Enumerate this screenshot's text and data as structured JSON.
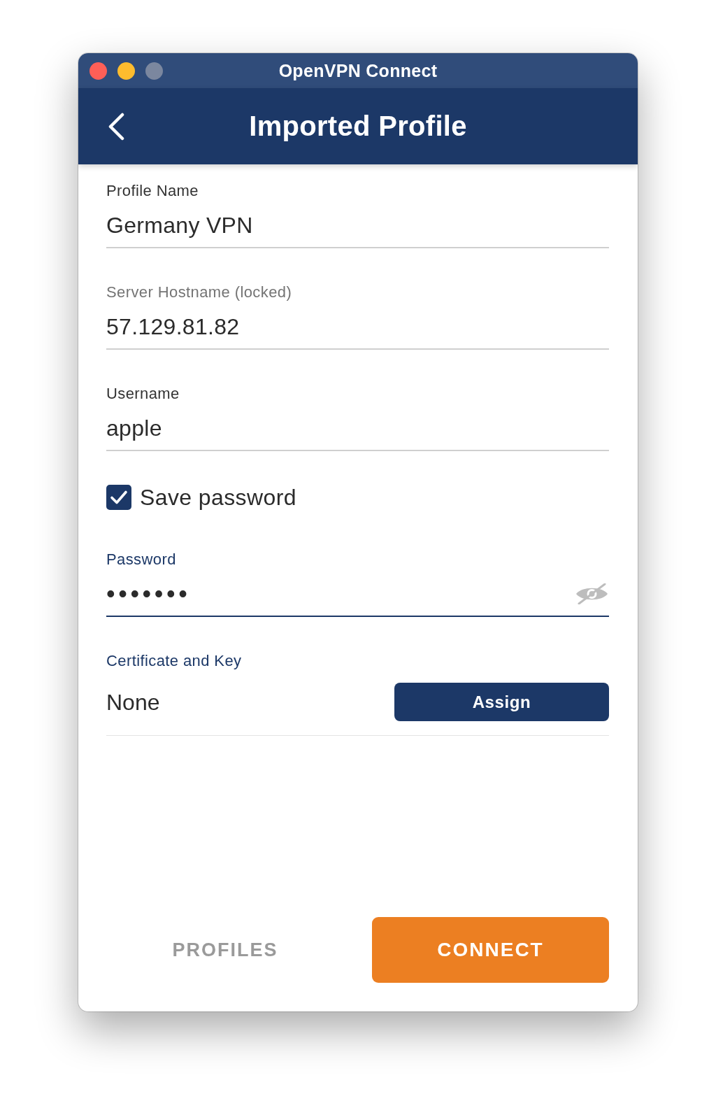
{
  "window": {
    "title": "OpenVPN Connect",
    "buttons": [
      {
        "kind": "close",
        "disabled": false
      },
      {
        "kind": "minimize",
        "disabled": false
      },
      {
        "kind": "zoom",
        "disabled": true
      }
    ]
  },
  "header": {
    "title": "Imported Profile"
  },
  "fields": [
    {
      "kind": "text",
      "label": "Profile Name",
      "value": "Germany VPN",
      "disabled": false,
      "focused": false
    },
    {
      "kind": "text",
      "label": "Server Hostname (locked)",
      "value": "57.129.81.82",
      "disabled": true,
      "focused": false
    },
    {
      "kind": "text",
      "label": "Username",
      "value": "apple",
      "disabled": false,
      "focused": false
    },
    {
      "kind": "checkbox",
      "label": "Save password",
      "checked": true
    },
    {
      "kind": "password",
      "label": "Password",
      "value": "•••••••",
      "focused": true,
      "revealed": false
    },
    {
      "kind": "certificate",
      "label": "Certificate and Key",
      "value": "None",
      "button": "Assign"
    }
  ],
  "footer": {
    "buttons": [
      {
        "kind": "text",
        "label": "PROFILES"
      },
      {
        "kind": "primary",
        "label": "CONNECT"
      }
    ]
  }
}
